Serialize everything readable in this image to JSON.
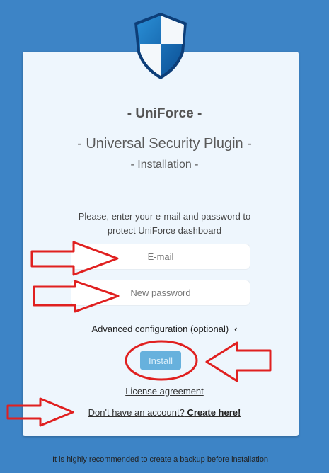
{
  "brand": "- UniForce -",
  "subtitle": "- Universal Security Plugin -",
  "step": "- Installation -",
  "prompt_line1": "Please, enter your e-mail and password to",
  "prompt_line2": "protect UniForce dashboard",
  "form": {
    "email_placeholder": "E-mail",
    "password_placeholder": "New password",
    "advanced_label": "Advanced configuration (optional)",
    "advanced_chevron": "‹",
    "install_label": "Install"
  },
  "links": {
    "license": "License agreement",
    "signup_prefix": "Don't have an account?",
    "signup_action": "Create here!"
  },
  "footer_note": "It is highly recommended to create a backup before installation",
  "icons": [
    "shield-icon",
    "chevron-left-icon"
  ],
  "colors": {
    "background": "#3d84c6",
    "card": "#eef6fd",
    "install_button": "#67b1dd",
    "annotation_red": "#e02020"
  }
}
